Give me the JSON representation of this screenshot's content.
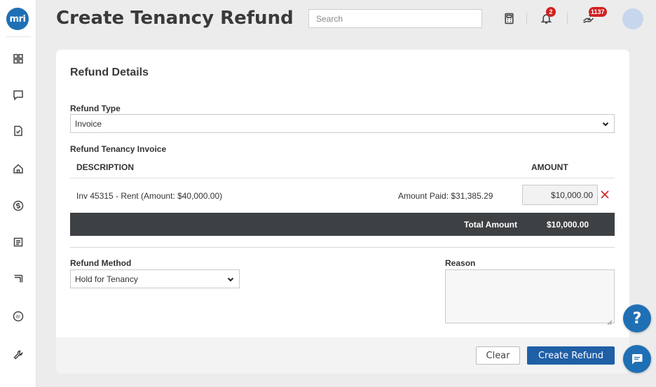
{
  "app": {
    "logo_text": "mri",
    "accent_color": "#1f6fb5",
    "danger_color": "#d32020"
  },
  "sidebar": {
    "items": [
      {
        "icon": "dashboard-grid-icon"
      },
      {
        "icon": "chat-bubble-icon"
      },
      {
        "icon": "document-check-icon"
      },
      {
        "icon": "home-icon"
      },
      {
        "icon": "dollar-circle-icon"
      },
      {
        "icon": "report-icon"
      },
      {
        "icon": "calendar-icon"
      },
      {
        "icon": "bi-circle-icon",
        "text": "BI"
      },
      {
        "icon": "wrench-icon"
      }
    ]
  },
  "header": {
    "title": "Create Tenancy Refund",
    "search_placeholder": "Search",
    "notifications_count": "2",
    "tasks_count": "1137"
  },
  "form": {
    "section_title": "Refund Details",
    "refund_type_label": "Refund Type",
    "refund_type_value": "Invoice",
    "invoice_section_label": "Refund Tenancy Invoice",
    "table": {
      "columns": [
        "DESCRIPTION",
        "AMOUNT"
      ],
      "rows": [
        {
          "description": "Inv 45315 - Rent (Amount: $40,000.00)",
          "amount_paid": "Amount Paid: $31,385.29",
          "amount": "$10,000.00"
        }
      ],
      "total_label": "Total Amount",
      "total_value": "$10,000.00"
    },
    "refund_method_label": "Refund Method",
    "refund_method_value": "Hold for Tenancy",
    "reason_label": "Reason",
    "reason_value": ""
  },
  "footer": {
    "clear_label": "Clear",
    "create_label": "Create Refund"
  },
  "floating": {
    "help_label": "?"
  }
}
